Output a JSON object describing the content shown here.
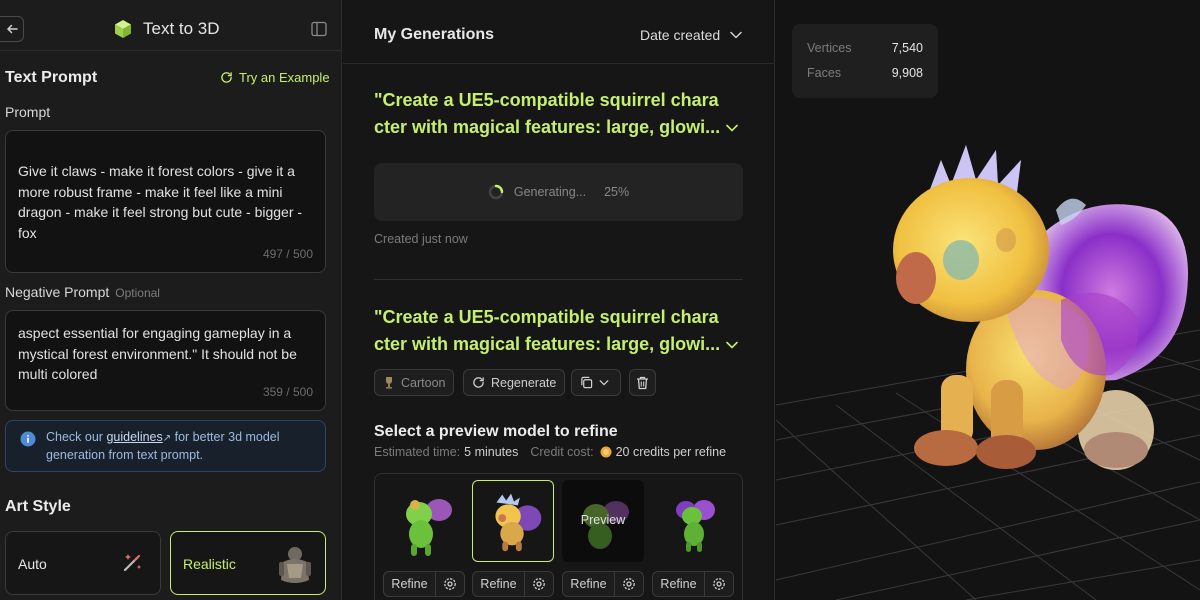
{
  "left_panel": {
    "title": "Text to 3D",
    "text_prompt_heading": "Text Prompt",
    "try_example": "Try an Example",
    "prompt_label": "Prompt",
    "prompt_value": "Give it claws - make it forest colors - give it a more robust frame - make it feel like a mini dragon - make it feel strong but cute - bigger - fox",
    "prompt_counter": "497 / 500",
    "negative_label": "Negative Prompt",
    "negative_optional": "Optional",
    "negative_value": "aspect essential for engaging gameplay in a mystical forest environment.\" It should not be multi colored",
    "negative_counter": "359 / 500",
    "info": {
      "prefix": "Check our ",
      "link": "guidelines",
      "suffix": " for better 3d model generation from text prompt."
    },
    "art_style_heading": "Art Style",
    "art_styles": [
      {
        "label": "Auto",
        "selected": false
      },
      {
        "label": "Realistic",
        "selected": true
      }
    ]
  },
  "middle_panel": {
    "title": "My Generations",
    "sort_label": "Date created",
    "generations": [
      {
        "prompt_line1": "\"Create a UE5-compatible squirrel chara",
        "prompt_line2": "cter with magical features: large, glowi...",
        "status_text": "Generating...",
        "progress": "25%",
        "created": "Created just now"
      },
      {
        "prompt_line1": "\"Create a UE5-compatible squirrel chara",
        "prompt_line2": "cter with magical features: large, glowi...",
        "style_chip": "Cartoon",
        "regenerate": "Regenerate"
      }
    ],
    "select_title": "Select a preview model to refine",
    "estimated_label": "Estimated time:",
    "estimated_value": "5 minutes",
    "credit_label": "Credit cost:",
    "credit_value": "20 credits per refine",
    "preview_overlay": "Preview",
    "refine_label": "Refine"
  },
  "viewport": {
    "stats": [
      {
        "label": "Vertices",
        "value": "7,540"
      },
      {
        "label": "Faces",
        "value": "9,908"
      }
    ]
  },
  "colors": {
    "accent": "#c7ef6e",
    "panel": "#1c1c1c",
    "info_text": "#9dbbe0"
  }
}
